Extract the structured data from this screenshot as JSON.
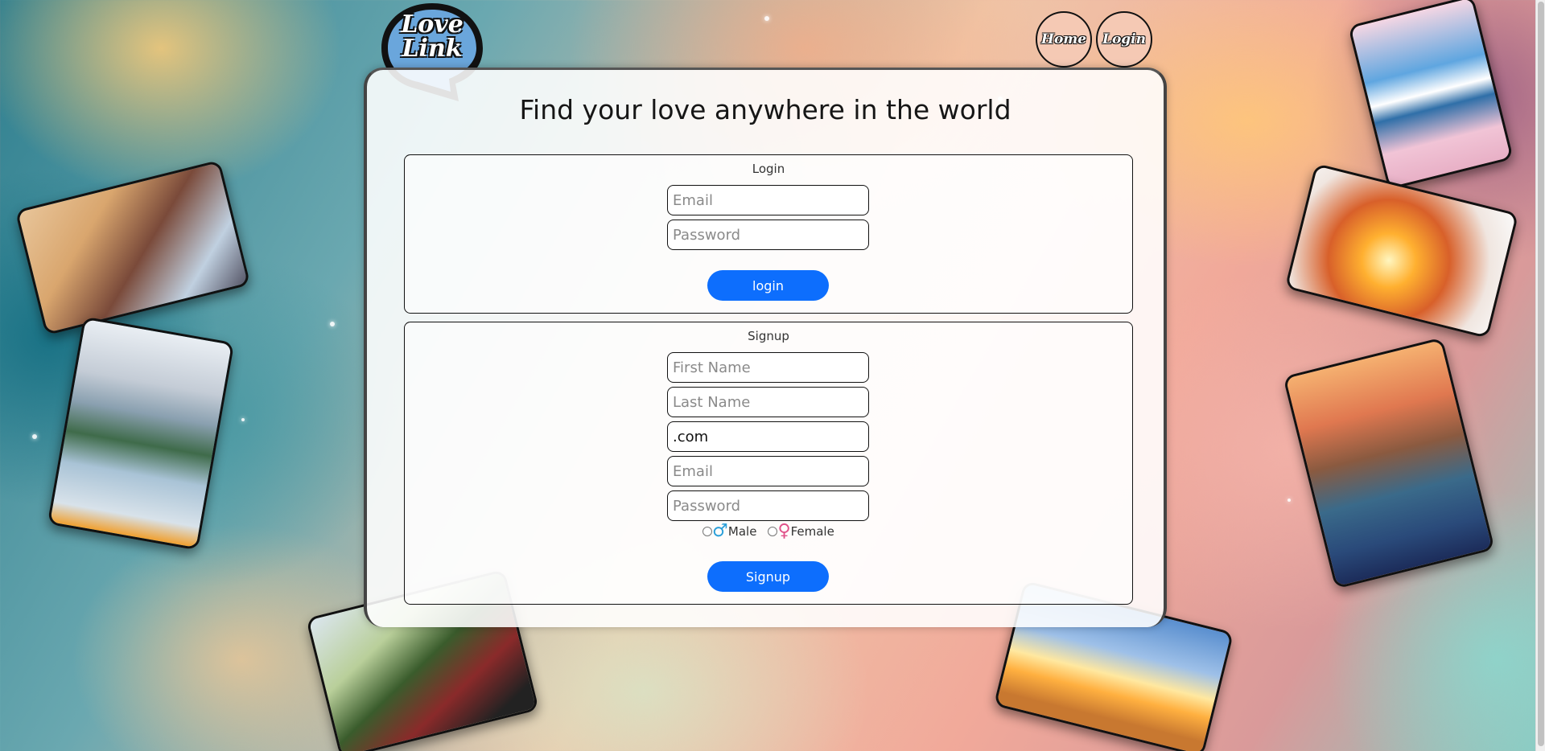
{
  "app": {
    "logo_line1": "Love",
    "logo_line2": "Link"
  },
  "nav": {
    "home_label": "Home",
    "login_label": "Login"
  },
  "page": {
    "headline": "Find your love anywhere in the world"
  },
  "login": {
    "title": "Login",
    "email_placeholder": "Email",
    "password_placeholder": "Password",
    "submit_label": "login"
  },
  "signup": {
    "title": "Signup",
    "first_name_placeholder": "First Name",
    "last_name_placeholder": "Last Name",
    "domain_value": ".com",
    "email_placeholder": "Email",
    "password_placeholder": "Password",
    "gender_options": [
      "Male",
      "Female"
    ],
    "male_symbol": "♂",
    "female_symbol": "♀",
    "submit_label": "Signup"
  },
  "colors": {
    "primary_button": "#0d6efd",
    "nav_button_fill": "#f5c9b4",
    "logo_bubble": "#6aa6dc",
    "male_symbol": "#2b9fd9",
    "female_symbol": "#e0528a"
  },
  "icons": [
    "logo-speech-bubble-icon",
    "male-symbol-icon",
    "female-symbol-icon"
  ]
}
